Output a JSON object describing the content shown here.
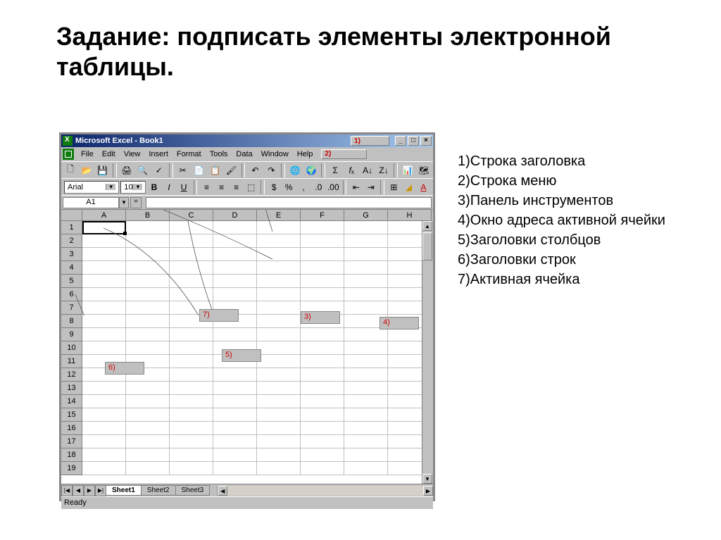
{
  "slide": {
    "title_bold": "Задание:",
    "title_rest": " подписать элементы электронной таблицы."
  },
  "answers": [
    "1)Строка заголовка",
    "2)Строка меню",
    "3)Панель инструментов",
    "4)Окно адреса активной ячейки",
    "5)Заголовки столбцов",
    "6)Заголовки строк",
    "7)Активная ячейка"
  ],
  "excel": {
    "titlebar": {
      "title": "Microsoft Excel - Book1",
      "label1": "1)",
      "min": "_",
      "max": "□",
      "close": "×"
    },
    "menu": {
      "items": [
        "File",
        "Edit",
        "View",
        "Insert",
        "Format",
        "Tools",
        "Data",
        "Window",
        "Help"
      ],
      "label2": "2)"
    },
    "font_name": "Arial",
    "font_size": "10",
    "name_box": "A1",
    "columns": [
      "A",
      "B",
      "C",
      "D",
      "E",
      "F",
      "G",
      "H"
    ],
    "rows": [
      "1",
      "2",
      "3",
      "4",
      "5",
      "6",
      "7",
      "8",
      "9",
      "10",
      "11",
      "12",
      "13",
      "14",
      "15",
      "16",
      "17",
      "18",
      "19"
    ],
    "sheets": [
      "Sheet1",
      "Sheet2",
      "Sheet3"
    ],
    "status": "Ready"
  },
  "callouts": {
    "c3": "3)",
    "c4": "4)",
    "c5": "5)",
    "c6": "6)",
    "c7": "7)"
  }
}
